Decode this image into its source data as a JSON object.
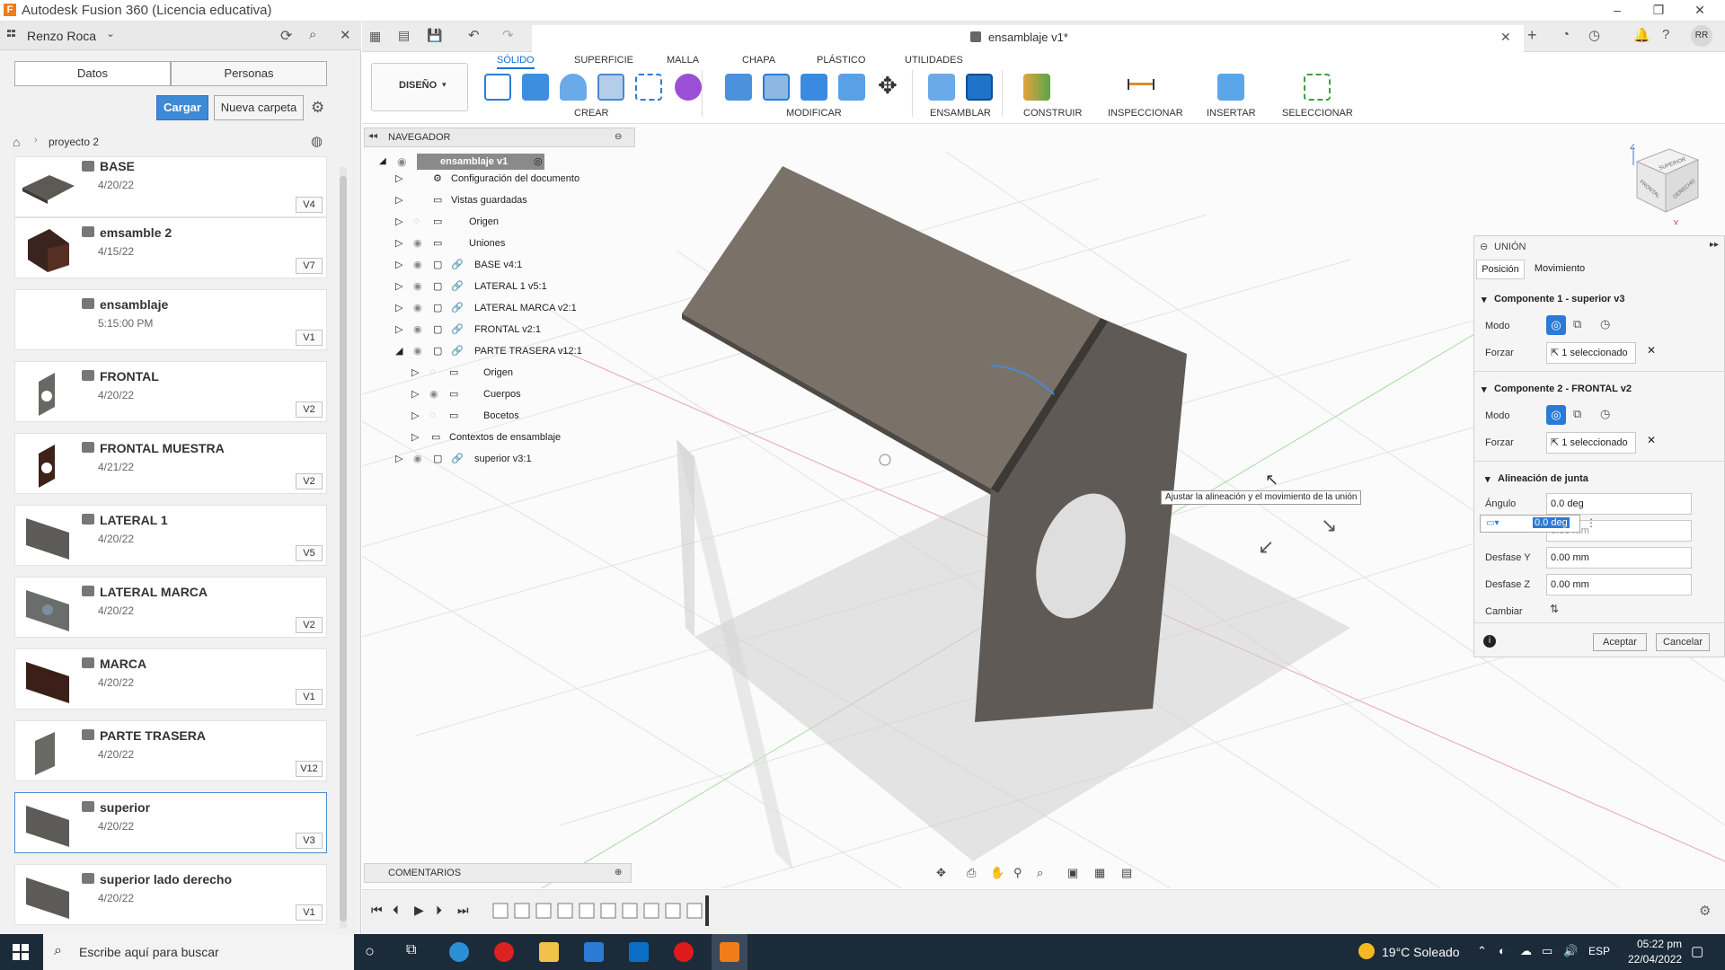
{
  "window": {
    "title": "Autodesk Fusion 360 (Licencia educativa)",
    "app_icon": "F"
  },
  "user": {
    "name": "Renzo Roca"
  },
  "data_panel": {
    "tabs": [
      "Datos",
      "Personas"
    ],
    "upload_label": "Cargar",
    "new_folder_label": "Nueva carpeta",
    "breadcrumb": "proyecto 2",
    "files": [
      {
        "name": "BASE",
        "date": "4/20/22",
        "version": "V4"
      },
      {
        "name": "emsamble 2",
        "date": "4/15/22",
        "version": "V7"
      },
      {
        "name": "ensamblaje",
        "date": "5:15:00 PM",
        "version": "V1"
      },
      {
        "name": "FRONTAL",
        "date": "4/20/22",
        "version": "V2"
      },
      {
        "name": "FRONTAL MUESTRA",
        "date": "4/21/22",
        "version": "V2"
      },
      {
        "name": "LATERAL 1",
        "date": "4/20/22",
        "version": "V5"
      },
      {
        "name": "LATERAL MARCA",
        "date": "4/20/22",
        "version": "V2"
      },
      {
        "name": "MARCA",
        "date": "4/20/22",
        "version": "V1"
      },
      {
        "name": "PARTE TRASERA",
        "date": "4/20/22",
        "version": "V12"
      },
      {
        "name": "superior",
        "date": "4/20/22",
        "version": "V3"
      },
      {
        "name": "superior lado derecho",
        "date": "4/20/22",
        "version": "V1"
      }
    ]
  },
  "document": {
    "tab_title": "ensamblaje v1*"
  },
  "ribbon": {
    "workspace": "DISEÑO",
    "tabs": [
      "SÓLIDO",
      "SUPERFICIE",
      "MALLA",
      "CHAPA",
      "PLÁSTICO",
      "UTILIDADES"
    ],
    "groups": [
      "CREAR",
      "MODIFICAR",
      "ENSAMBLAR",
      "CONSTRUIR",
      "INSPECCIONAR",
      "INSERTAR",
      "SELECCIONAR"
    ]
  },
  "navigator": {
    "title": "NAVEGADOR",
    "root": "ensamblaje v1",
    "items": [
      "Configuración del documento",
      "Vistas guardadas",
      "Origen",
      "Uniones",
      "BASE v4:1",
      "LATERAL 1 v5:1",
      "LATERAL MARCA v2:1",
      "FRONTAL v2:1",
      "PARTE TRASERA v12:1",
      "Origen",
      "Cuerpos",
      "Bocetos",
      "Contextos de ensamblaje",
      "superior v3:1"
    ]
  },
  "tooltip": "Ajustar la alineación y el movimiento de la unión",
  "union_panel": {
    "title": "UNIÓN",
    "tabs": [
      "Posición",
      "Movimiento"
    ],
    "component1": "Componente 1 - superior v3",
    "component2": "Componente 2 - FRONTAL v2",
    "mode_label": "Modo",
    "force_label": "Forzar",
    "selected_text": "1 seleccionado",
    "alignment_title": "Alineación de junta",
    "angle_label": "Ángulo",
    "angle_value": "0.0 deg",
    "angle_edit": "0.0 deg",
    "offset_x_partial": "0.00 mm",
    "offset_y_label": "Desfase Y",
    "offset_y_value": "0.00 mm",
    "offset_z_label": "Desfase Z",
    "offset_z_value": "0.00 mm",
    "change_label": "Cambiar",
    "ok_label": "Aceptar",
    "cancel_label": "Cancelar"
  },
  "comments_label": "COMENTARIOS",
  "taskbar": {
    "search_placeholder": "Escribe aquí para buscar",
    "weather": "19°C  Soleado",
    "lang": "ESP",
    "time": "05:22 pm",
    "date": "22/04/2022"
  },
  "viewcube": {
    "top": "SUPERIOR",
    "front": "FRONTAL",
    "right": "DERECHO"
  }
}
